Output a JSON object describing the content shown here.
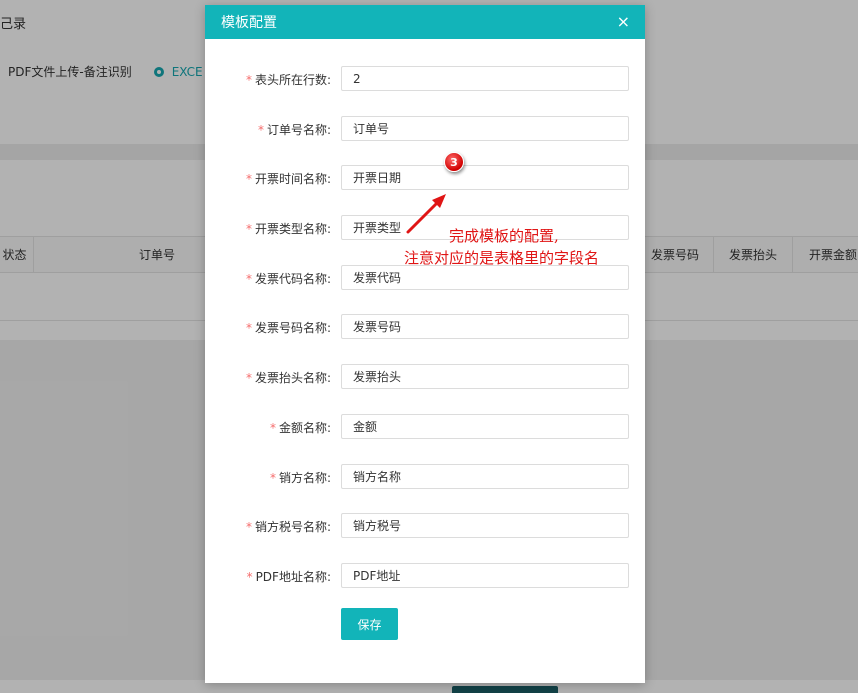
{
  "background": {
    "title_fragment": "己录",
    "options": [
      {
        "label": "PDF文件上传-备注识别",
        "selected": false
      },
      {
        "label": "EXCE",
        "selected": true
      }
    ],
    "table_headers": {
      "status": "状态",
      "order_no": "订单号",
      "invoice_number": "发票号码",
      "invoice_title": "发票抬头",
      "invoice_amount": "开票金额"
    }
  },
  "modal": {
    "title": "模板配置",
    "close_symbol": "×",
    "fields": [
      {
        "label": "表头所在行数:",
        "value": "2"
      },
      {
        "label": "订单号名称:",
        "value": "订单号"
      },
      {
        "label": "开票时间名称:",
        "value": "开票日期"
      },
      {
        "label": "开票类型名称:",
        "value": "开票类型"
      },
      {
        "label": "发票代码名称:",
        "value": "发票代码"
      },
      {
        "label": "发票号码名称:",
        "value": "发票号码"
      },
      {
        "label": "发票抬头名称:",
        "value": "发票抬头"
      },
      {
        "label": "金额名称:",
        "value": "金额"
      },
      {
        "label": "销方名称:",
        "value": "销方名称"
      },
      {
        "label": "销方税号名称:",
        "value": "销方税号"
      },
      {
        "label": "PDF地址名称:",
        "value": "PDF地址"
      }
    ],
    "required_mark": "*",
    "save_label": "保存"
  },
  "annotation": {
    "step_number": "3",
    "line1": "完成模板的配置,",
    "line2": "注意对应的是表格里的字段名"
  },
  "colors": {
    "accent": "#12b4b9",
    "required": "#f56c6c",
    "annotation": "#e01515"
  }
}
